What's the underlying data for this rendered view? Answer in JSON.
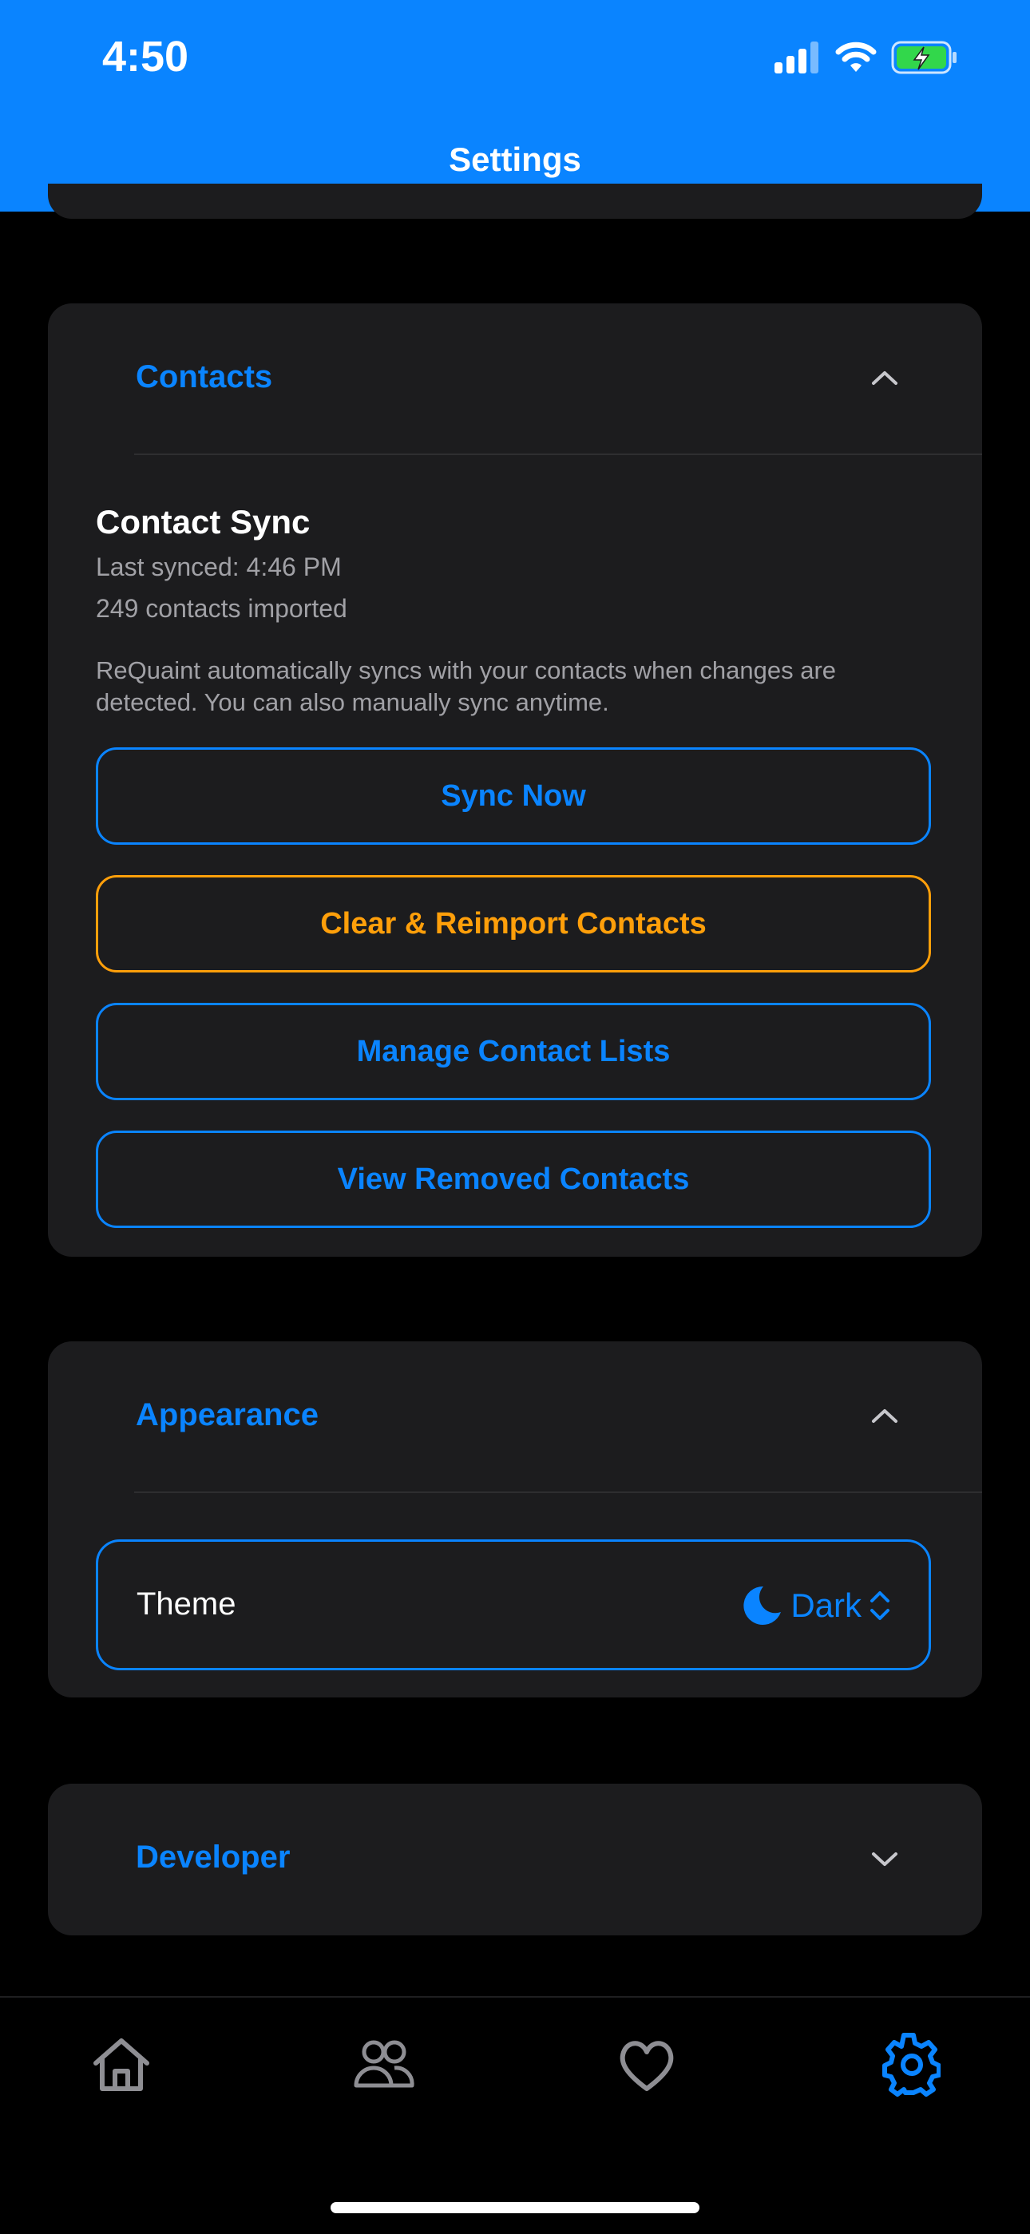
{
  "status_bar": {
    "time": "4:50",
    "icons": [
      "signal-icon",
      "wifi-icon",
      "battery-charging-icon"
    ]
  },
  "header": {
    "title": "Settings"
  },
  "contacts_card": {
    "title": "Contacts",
    "sync_title": "Contact Sync",
    "last_synced": "Last synced: 4:46 PM",
    "imported_count": "249 contacts imported",
    "description": "ReQuaint automatically syncs with your contacts when changes are detected. You can also manually sync anytime.",
    "buttons": {
      "sync_now": "Sync Now",
      "clear_reimport": "Clear & Reimport Contacts",
      "manage_lists": "Manage Contact Lists",
      "view_removed": "View Removed Contacts"
    }
  },
  "appearance_card": {
    "title": "Appearance",
    "theme_label": "Theme",
    "theme_value": "Dark"
  },
  "developer_card": {
    "title": "Developer"
  },
  "tab_bar": {
    "items": [
      "home-icon",
      "people-icon",
      "heart-icon",
      "gear-icon"
    ],
    "active": "gear-icon"
  },
  "colors": {
    "accent": "#0a84ff",
    "warning": "#ff9f0a",
    "card_bg": "#1c1c1e",
    "background": "#000000",
    "inactive_icon": "#8e8e93"
  }
}
